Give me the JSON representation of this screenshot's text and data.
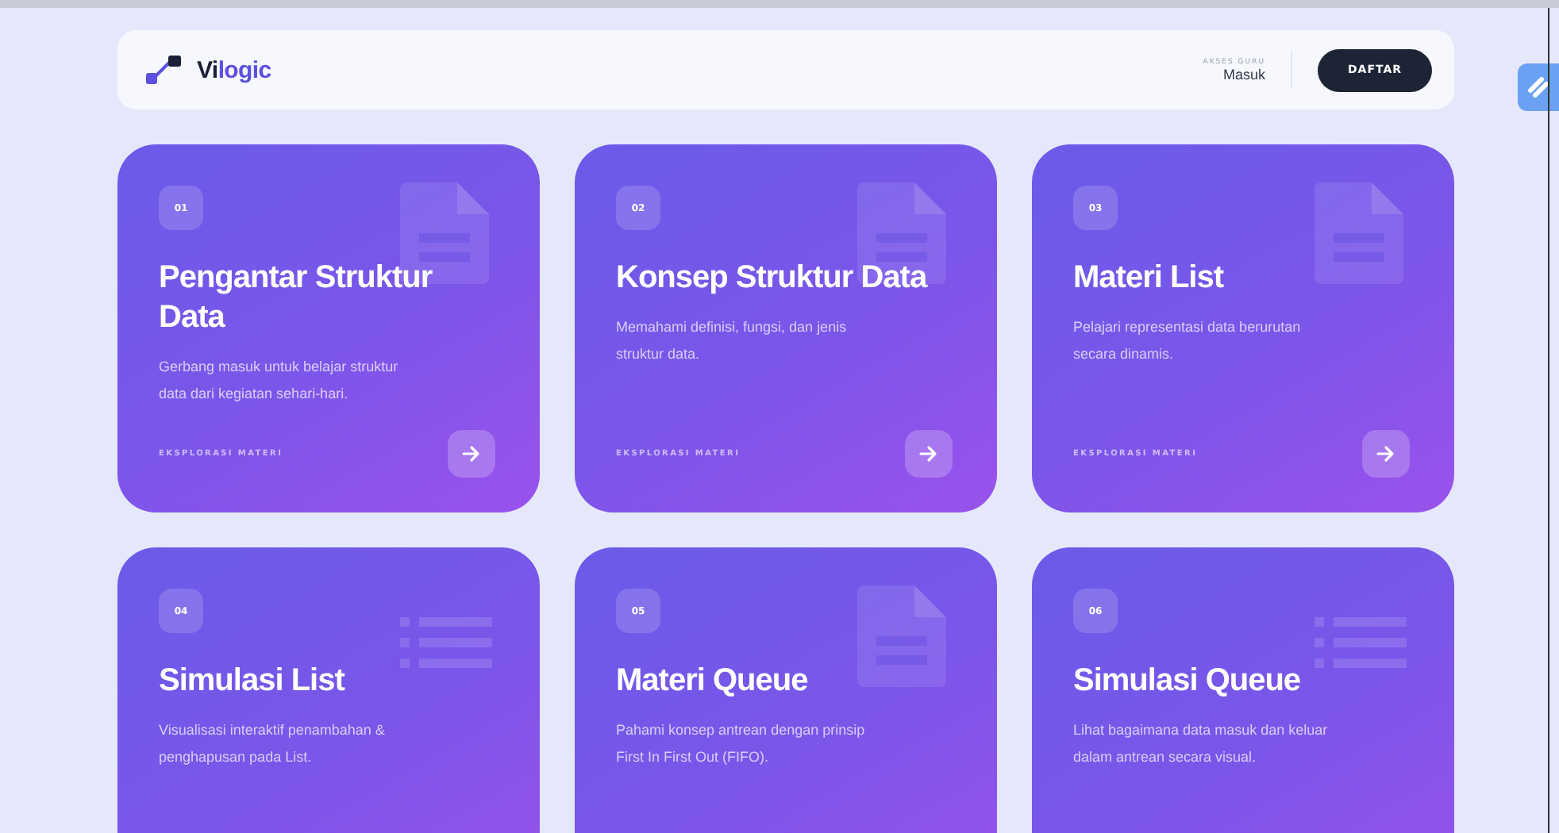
{
  "navbar": {
    "logo": {
      "prefix": "Vi",
      "suffix": "logic"
    },
    "access_label": "AKSES GURU",
    "login": "Masuk",
    "register": "DAFTAR"
  },
  "cards": [
    {
      "number": "01",
      "kind": "document",
      "title": "Pengantar Struktur Data",
      "description": "Gerbang masuk untuk belajar struktur data dari kegiatan sehari-hari.",
      "link": "EKSPLORASI MATERI"
    },
    {
      "number": "02",
      "kind": "document",
      "title": "Konsep Struktur Data",
      "description": "Memahami definisi, fungsi, dan jenis struktur data.",
      "link": "EKSPLORASI MATERI"
    },
    {
      "number": "03",
      "kind": "document",
      "title": "Materi List",
      "description": "Pelajari representasi data berurutan secara dinamis.",
      "link": "EKSPLORASI MATERI"
    },
    {
      "number": "04",
      "kind": "list",
      "title": "Simulasi List",
      "description": "Visualisasi interaktif penambahan & penghapusan pada List."
    },
    {
      "number": "05",
      "kind": "document",
      "title": "Materi Queue",
      "description": "Pahami konsep antrean dengan prinsip First In First Out (FIFO)."
    },
    {
      "number": "06",
      "kind": "list",
      "title": "Simulasi Queue",
      "description": "Lihat bagaimana data masuk dan keluar dalam antrean secara visual."
    }
  ]
}
